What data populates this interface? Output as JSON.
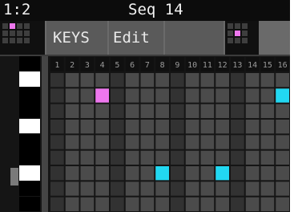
{
  "title_bar": {
    "slot": "1:2",
    "title": "Seq 14"
  },
  "menu": {
    "keys_label": "KEYS",
    "edit_label": "Edit"
  },
  "piano": {
    "row_colors": [
      "black",
      "white",
      "black",
      "black",
      "white",
      "black",
      "black",
      "white",
      "black",
      "black"
    ]
  },
  "step_columns": [
    "1",
    "2",
    "3",
    "4",
    "5",
    "6",
    "7",
    "8",
    "9",
    "10",
    "11",
    "12",
    "13",
    "14",
    "15",
    "16"
  ],
  "step_shading": [
    "dark",
    "mid",
    "mid",
    "mid",
    "dark",
    "mid",
    "mid",
    "mid",
    "dark",
    "mid",
    "mid",
    "mid",
    "dark",
    "mid",
    "mid",
    "mid"
  ],
  "num_rows": 9,
  "notes": [
    {
      "step": 4,
      "row": 1,
      "color": "#ee77ee"
    },
    {
      "step": 16,
      "row": 1,
      "color": "#22d8f2"
    },
    {
      "step": 8,
      "row": 6,
      "color": "#22d8f2"
    },
    {
      "step": 12,
      "row": 6,
      "color": "#22d8f2"
    }
  ],
  "mini_left": {
    "cols": 4,
    "rows": 3,
    "active_col": 1,
    "active_row": 0,
    "active_color": "#ee77ee"
  },
  "mini_right": {
    "cols": 3,
    "rows": 3,
    "active_col": 1,
    "active_row": 1,
    "active_color": "#ee77ee"
  },
  "colors": {
    "header_bg": "#101010",
    "header_text": "#9a9a9a",
    "dark_col": "#323232",
    "mid_col": "#4b4b4b",
    "grid_line": "#151515"
  }
}
